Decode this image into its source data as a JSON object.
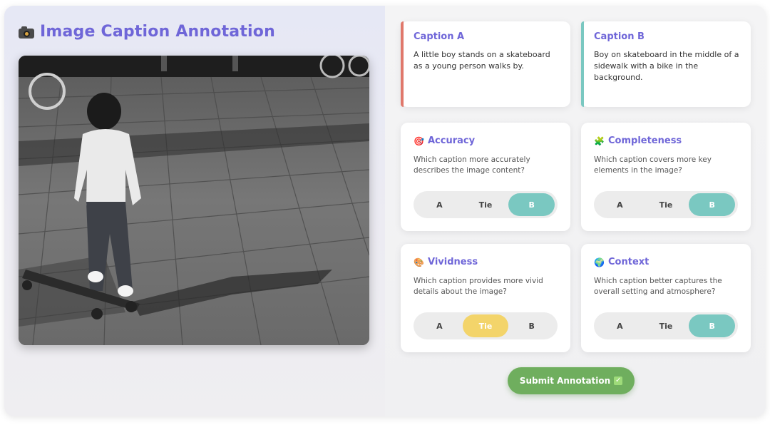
{
  "header": {
    "title": "Image Caption Annotation",
    "icon": "camera-icon"
  },
  "photo": {
    "description_icon": "photo-boy-skateboard"
  },
  "captions": [
    {
      "label": "Caption A",
      "text": "A little boy stands on a skateboard as a young person walks by.",
      "accent": "#e0786b"
    },
    {
      "label": "Caption B",
      "text": "Boy on skateboard in the middle of a sidewalk with a bike in the background.",
      "accent": "#7ac8c1"
    }
  ],
  "criteria": [
    {
      "title": "Accuracy",
      "icon": "target-icon",
      "question": "Which caption more accurately describes the image content?",
      "options": [
        "A",
        "Tie",
        "B"
      ],
      "selected": "B"
    },
    {
      "title": "Completeness",
      "icon": "puzzle-icon",
      "question": "Which caption covers more key elements in the image?",
      "options": [
        "A",
        "Tie",
        "B"
      ],
      "selected": "B"
    },
    {
      "title": "Vividness",
      "icon": "palette-icon",
      "question": "Which caption provides more vivid details about the image?",
      "options": [
        "A",
        "Tie",
        "B"
      ],
      "selected": "Tie"
    },
    {
      "title": "Context",
      "icon": "globe-icon",
      "question": "Which caption better captures the overall setting and atmosphere?",
      "options": [
        "A",
        "Tie",
        "B"
      ],
      "selected": "B"
    }
  ],
  "submit": {
    "label": "Submit Annotation",
    "icon": "check-icon"
  },
  "colors": {
    "accent_text": "#6f66d8",
    "selected_b": "#7ac8c1",
    "selected_tie": "#f3d46a",
    "submit": "#6fae5e"
  }
}
